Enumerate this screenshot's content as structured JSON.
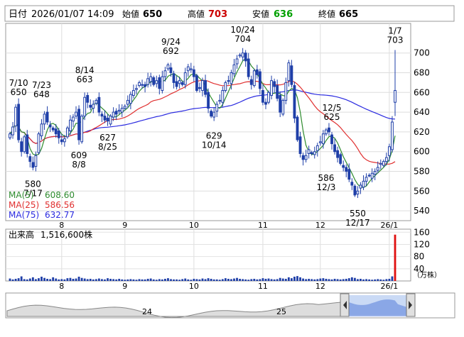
{
  "header": {
    "date_label": "日付",
    "datetime": "2026/01/07 14:09",
    "open_label": "始値",
    "open": "650",
    "high_label": "高値",
    "high": "703",
    "low_label": "安値",
    "low": "636",
    "close_label": "終値",
    "close": "665"
  },
  "colors": {
    "up": "#00a000",
    "down": "#cc0000",
    "candle": "#1f3fa8",
    "ma5": "#2e8b2e",
    "ma25": "#e03030",
    "ma75": "#2a2ae0",
    "volume": "#1f3fa8",
    "volume_last": "#e01010"
  },
  "ma_legend": [
    {
      "label": "MA(5)",
      "value": "608.60"
    },
    {
      "label": "MA(25)",
      "value": "586.56"
    },
    {
      "label": "MA(75)",
      "value": "632.77"
    }
  ],
  "volume_legend": {
    "label": "出来高",
    "value": "1,516,600株"
  },
  "volume_unit": "（万株）",
  "navigator_labels": [
    "24",
    "25"
  ],
  "chart_data": {
    "type": "candlestick",
    "price_ylim": [
      530,
      730
    ],
    "price_ticks": [
      540,
      560,
      580,
      600,
      620,
      640,
      660,
      680,
      700
    ],
    "volume_ylim": [
      0,
      170
    ],
    "volume_ticks": [
      40,
      80,
      120,
      160
    ],
    "months": [
      {
        "label": "8",
        "index": 18
      },
      {
        "label": "9",
        "index": 40
      },
      {
        "label": "10",
        "index": 64
      },
      {
        "label": "11",
        "index": 88
      },
      {
        "label": "12",
        "index": 108
      },
      {
        "label": "26/1",
        "index": 132
      }
    ],
    "annotations": [
      {
        "date": "7/10",
        "value": 650,
        "index": 3,
        "position": "above"
      },
      {
        "date": "7/23",
        "value": 648,
        "index": 11,
        "position": "above"
      },
      {
        "date": "8/14",
        "value": 663,
        "index": 26,
        "position": "above"
      },
      {
        "date": "9/24",
        "value": 692,
        "index": 56,
        "position": "above"
      },
      {
        "date": "10/24",
        "value": 704,
        "index": 81,
        "position": "above"
      },
      {
        "date": "12/5",
        "value": 625,
        "index": 112,
        "position": "above"
      },
      {
        "date": "1/7",
        "value": 703,
        "index": 134,
        "position": "above"
      },
      {
        "date": "7/17",
        "value": 580,
        "index": 8,
        "position": "below"
      },
      {
        "date": "8/8",
        "value": 609,
        "index": 24,
        "position": "below"
      },
      {
        "date": "8/25",
        "value": 627,
        "index": 34,
        "position": "below"
      },
      {
        "date": "10/14",
        "value": 629,
        "index": 71,
        "position": "below"
      },
      {
        "date": "12/3",
        "value": 586,
        "index": 110,
        "position": "below"
      },
      {
        "date": "12/17",
        "value": 550,
        "index": 121,
        "position": "below"
      }
    ],
    "close": [
      618,
      625,
      645,
      612,
      600,
      615,
      598,
      590,
      584,
      596,
      618,
      628,
      638,
      630,
      625,
      622,
      618,
      614,
      610,
      613,
      624,
      632,
      635,
      640,
      612,
      636,
      655,
      650,
      645,
      648,
      652,
      640,
      636,
      632,
      631,
      636,
      640,
      638,
      642,
      644,
      646,
      652,
      658,
      662,
      664,
      670,
      668,
      666,
      674,
      676,
      668,
      672,
      664,
      676,
      682,
      688,
      680,
      670,
      666,
      672,
      668,
      680,
      686,
      684,
      676,
      662,
      664,
      672,
      658,
      644,
      636,
      640,
      648,
      652,
      662,
      670,
      672,
      680,
      688,
      694,
      698,
      700,
      692,
      676,
      668,
      682,
      678,
      664,
      650,
      648,
      660,
      672,
      666,
      654,
      640,
      652,
      670,
      690,
      668,
      634,
      612,
      598,
      592,
      596,
      602,
      598,
      600,
      606,
      610,
      618,
      622,
      620,
      608,
      600,
      594,
      588,
      584,
      580,
      572,
      566,
      556,
      560,
      566,
      570,
      574,
      576,
      578,
      580,
      584,
      588,
      590,
      594,
      605,
      630,
      662
    ],
    "volume": [
      8,
      5,
      7,
      9,
      15,
      6,
      5,
      8,
      12,
      6,
      9,
      14,
      10,
      7,
      6,
      12,
      8,
      5,
      6,
      5,
      9,
      10,
      7,
      8,
      14,
      10,
      8,
      6,
      7,
      5,
      6,
      8,
      6,
      5,
      9,
      7,
      6,
      5,
      7,
      5,
      4,
      5,
      6,
      5,
      4,
      6,
      5,
      5,
      7,
      8,
      5,
      4,
      6,
      5,
      7,
      9,
      6,
      5,
      5,
      4,
      6,
      8,
      5,
      4,
      7,
      6,
      5,
      8,
      6,
      9,
      7,
      5,
      5,
      4,
      6,
      9,
      7,
      6,
      8,
      10,
      7,
      6,
      5,
      4,
      6,
      7,
      5,
      6,
      9,
      7,
      8,
      6,
      5,
      6,
      10,
      8,
      7,
      12,
      9,
      14,
      16,
      12,
      8,
      6,
      7,
      6,
      5,
      6,
      8,
      9,
      7,
      6,
      5,
      7,
      6,
      5,
      6,
      7,
      9,
      12,
      10,
      6,
      7,
      5,
      6,
      5,
      4,
      5,
      6,
      5,
      4,
      6,
      7,
      15,
      152
    ]
  }
}
